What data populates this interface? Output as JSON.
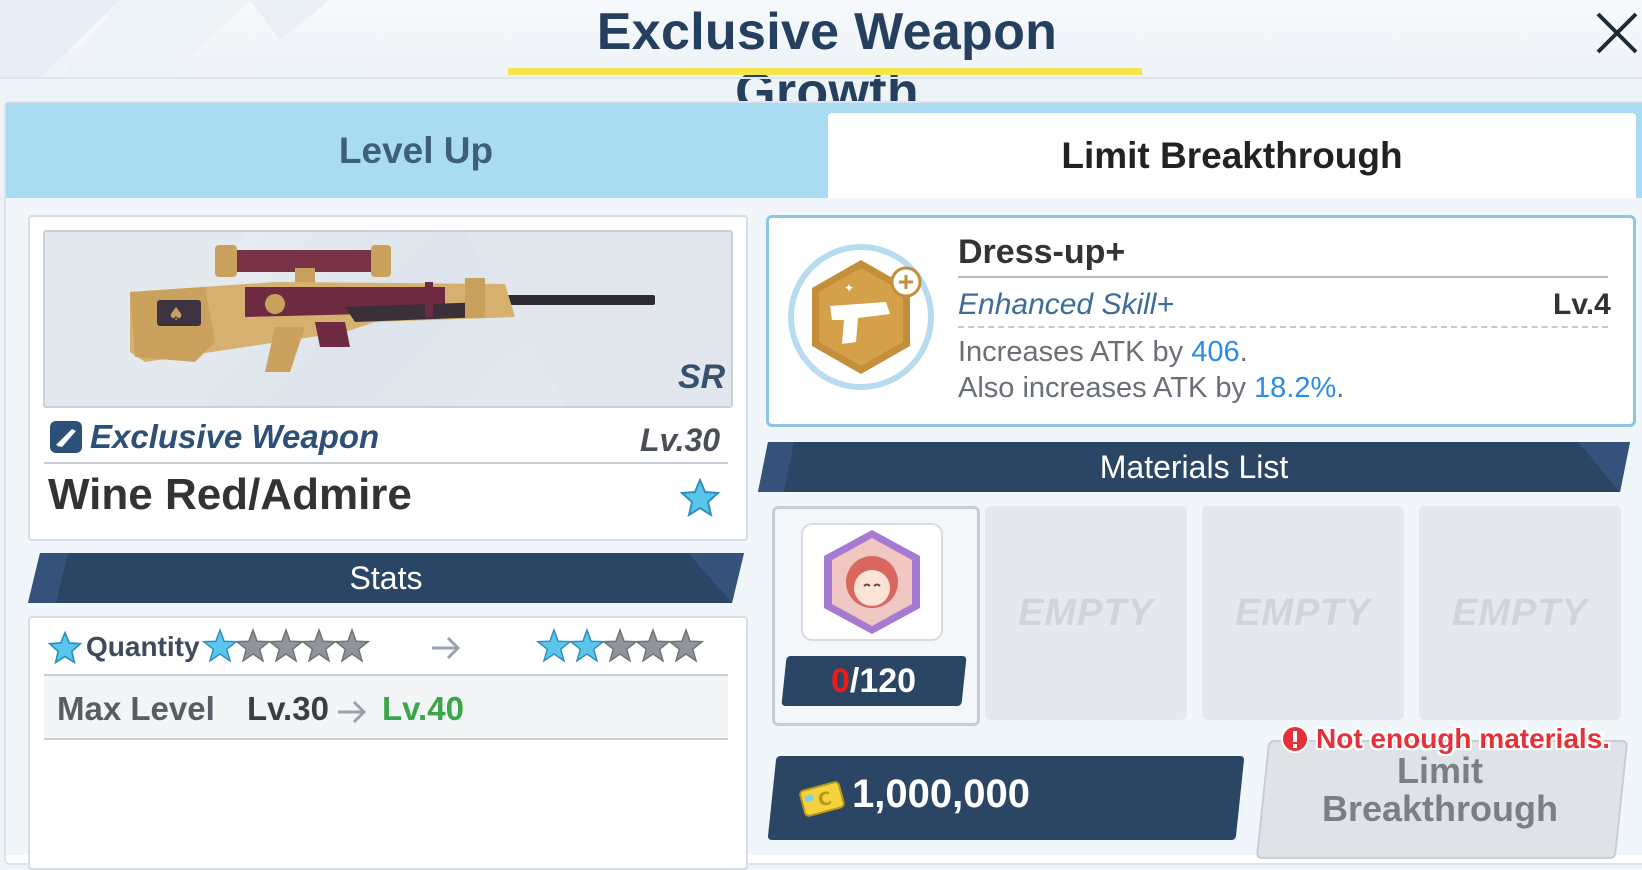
{
  "header": {
    "title": "Exclusive Weapon Growth",
    "close_icon": "close-icon"
  },
  "tabs": [
    {
      "label": "Level Up",
      "active": false
    },
    {
      "label": "Limit Breakthrough",
      "active": true
    }
  ],
  "weapon": {
    "rarity": "SR",
    "type_label": "Exclusive Weapon",
    "level": "Lv.30",
    "name": "Wine Red/Admire"
  },
  "stats": {
    "banner": "Stats",
    "quantity_label": "Quantity",
    "stars_before": {
      "filled": 1,
      "total": 5
    },
    "stars_after": {
      "filled": 2,
      "total": 5
    },
    "max_level_label": "Max Level",
    "max_level_from": "Lv.30",
    "max_level_to": "Lv.40"
  },
  "skill": {
    "title": "Dress-up+",
    "subtitle": "Enhanced Skill+",
    "level": "Lv.4",
    "desc1_prefix": "Increases ATK by ",
    "desc1_value": "406",
    "desc1_suffix": ".",
    "desc2_prefix": "Also increases ATK by ",
    "desc2_value": "18.2%",
    "desc2_suffix": "."
  },
  "materials": {
    "banner": "Materials List",
    "item": {
      "owned": "0",
      "required": "/120"
    },
    "empty_label": "EMPTY"
  },
  "cost": {
    "value": "1,000,000"
  },
  "warning": "Not enough materials.",
  "button": {
    "line1": "Limit",
    "line2": "Breakthrough"
  },
  "colors": {
    "accent_dark": "#2b4564",
    "tab_inactive": "#a9dcf2",
    "highlight": "#2a8ce6",
    "warning": "#e5323a",
    "level_up": "#3aa64a"
  }
}
